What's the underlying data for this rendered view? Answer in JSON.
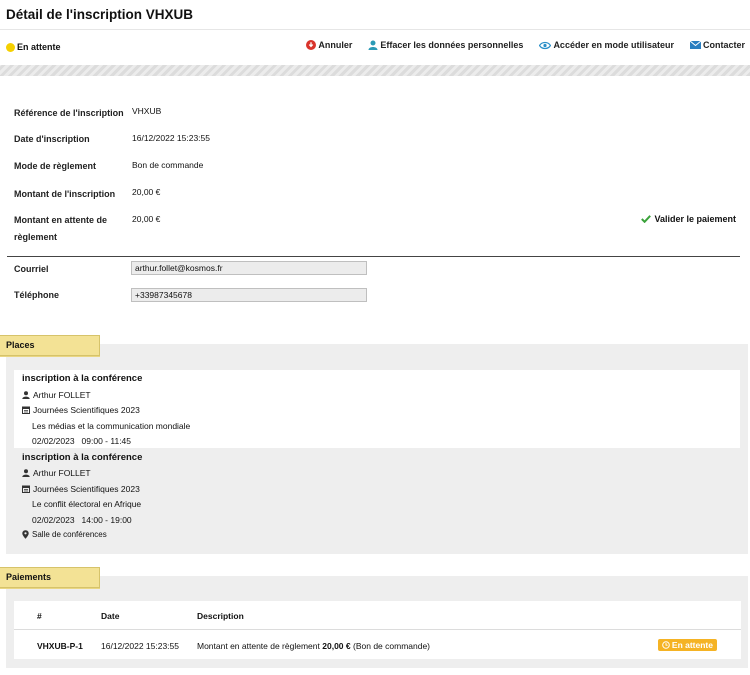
{
  "page": {
    "title": "Détail de l'inscription VHXUB"
  },
  "status": {
    "label": "En attente",
    "color": "#f5d000"
  },
  "actions": [
    {
      "label": "Annuler",
      "icon": "cancel-icon"
    },
    {
      "label": "Effacer les données personnelles",
      "icon": "user-icon"
    },
    {
      "label": "Accéder en mode utilisateur",
      "icon": "eye-icon"
    },
    {
      "label": "Contacter",
      "icon": "envelope-icon"
    }
  ],
  "details": {
    "reference_label": "Référence de l'inscription",
    "reference_value": "VHXUB",
    "date_label": "Date d'inscription",
    "date_value": "16/12/2022 15:23:55",
    "mode_label": "Mode de règlement",
    "mode_value": "Bon de commande",
    "amount_label": "Montant de l'inscription",
    "amount_value": "20,00 €",
    "pending_label_1": "Montant en attente de",
    "pending_label_2": "règlement",
    "pending_value": "20,00 €",
    "validate_label": "Valider le paiement",
    "email_label": "Courriel",
    "email_value": "arthur.follet@kosmos.fr",
    "phone_label": "Téléphone",
    "phone_value": "+33987345678"
  },
  "places": {
    "tab_label": "Places",
    "items": [
      {
        "title": "inscription à la conférence",
        "person": "Arthur FOLLET",
        "event": "Journées Scientifiques 2023",
        "session": "Les médias et la communication mondiale",
        "date": "02/02/2023",
        "time": "09:00 - 11:45"
      },
      {
        "title": "inscription à la conférence",
        "person": "Arthur FOLLET",
        "event": "Journées Scientifiques 2023",
        "session": "Le conflit électoral en Afrique",
        "date": "02/02/2023",
        "time": "14:00 - 19:00",
        "location": "Salle de conférences"
      }
    ]
  },
  "payments": {
    "tab_label": "Paiements",
    "headers": {
      "id": "#",
      "date": "Date",
      "description": "Description"
    },
    "rows": [
      {
        "id": "VHXUB-P-1",
        "date": "16/12/2022 15:23:55",
        "desc_prefix": "Montant en attente de règlement",
        "desc_amount": "20,00 €",
        "desc_suffix": "(Bon de commande)",
        "status": "En attente",
        "status_color": "#f5b324"
      }
    ]
  }
}
